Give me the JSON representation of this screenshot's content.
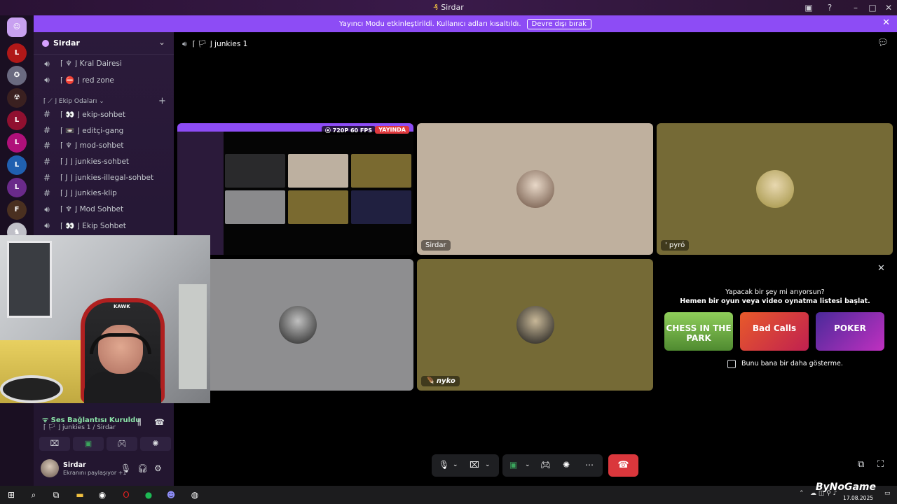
{
  "window": {
    "title": "Sirdar"
  },
  "banner": {
    "text": "Yayıncı Modu etkinleştirildi. Kullanıcı adları kısaltıldı.",
    "button": "Devre dışı bırak"
  },
  "server": {
    "name": "Sirdar"
  },
  "channels": [
    {
      "type": "voice",
      "label": "⌈ ♆ ⌋ Kral Dairesi"
    },
    {
      "type": "voice",
      "label": "⌈ ⛔ ⌋ red zone"
    },
    {
      "type": "text",
      "label": "⌈ 👀 ⌋ ekip-sohbet"
    },
    {
      "type": "text",
      "label": "⌈ 📼 ⌋ editçi-gang"
    },
    {
      "type": "text",
      "label": "⌈ ♆ ⌋ mod-sohbet"
    },
    {
      "type": "text",
      "label": "⌈ J ⌋ junkies-sohbet"
    },
    {
      "type": "text",
      "label": "⌈ J ⌋ junkies-illegal-sohbet"
    },
    {
      "type": "text",
      "label": "⌈ J ⌋ junkies-klip"
    },
    {
      "type": "voice",
      "label": "⌈ ♆ ⌋ Mod Sohbet"
    },
    {
      "type": "voice",
      "label": "⌈ 👀 ⌋ Ekip Sohbet"
    }
  ],
  "category": {
    "label": "⌈ ⟋ ⌋ Ekip Odaları ⌄"
  },
  "voice_status": {
    "status": "Ses Bağlantısı Kuruldu",
    "channel": "⌈ 🏳 ⌋ junkies 1 / Sirdar"
  },
  "user": {
    "name": "Sirdar",
    "status": "Ekranını paylaşıyor +1"
  },
  "webcam": {
    "brand": "KAWK"
  },
  "voice_channel": {
    "title": "⌈ 🏳 ⌋ junkies 1"
  },
  "stream": {
    "fps_badge": "⦿ 720P 60 FPS",
    "live_badge": "YAYINDA"
  },
  "tiles": [
    {
      "name": "Sirdar"
    },
    {
      "name": "' pyró"
    },
    {
      "name": ""
    },
    {
      "name": "🪶 nyko"
    }
  ],
  "activity": {
    "question": "Yapacak bir şey mi arıyorsun?",
    "prompt": "Hemen bir oyun veya video oynatma listesi başlat.",
    "games": [
      "CHESS IN THE PARK",
      "Bad Calls",
      "POKER"
    ],
    "checkbox_label": "Bunu bana bir daha gösterme."
  },
  "taskbar": {
    "date": "17.08.2025"
  },
  "watermark": "ByNoGame",
  "colors": {
    "accent": "#8d4cf5",
    "end_call": "#da373c",
    "live": "#e03a3e",
    "connected": "#8be3a8"
  },
  "icons": [
    "discord-icon",
    "speaker-icon",
    "hash-icon",
    "mic-icon",
    "headphones-icon",
    "gear-icon",
    "close-icon",
    "chat-icon",
    "end-call-icon"
  ]
}
